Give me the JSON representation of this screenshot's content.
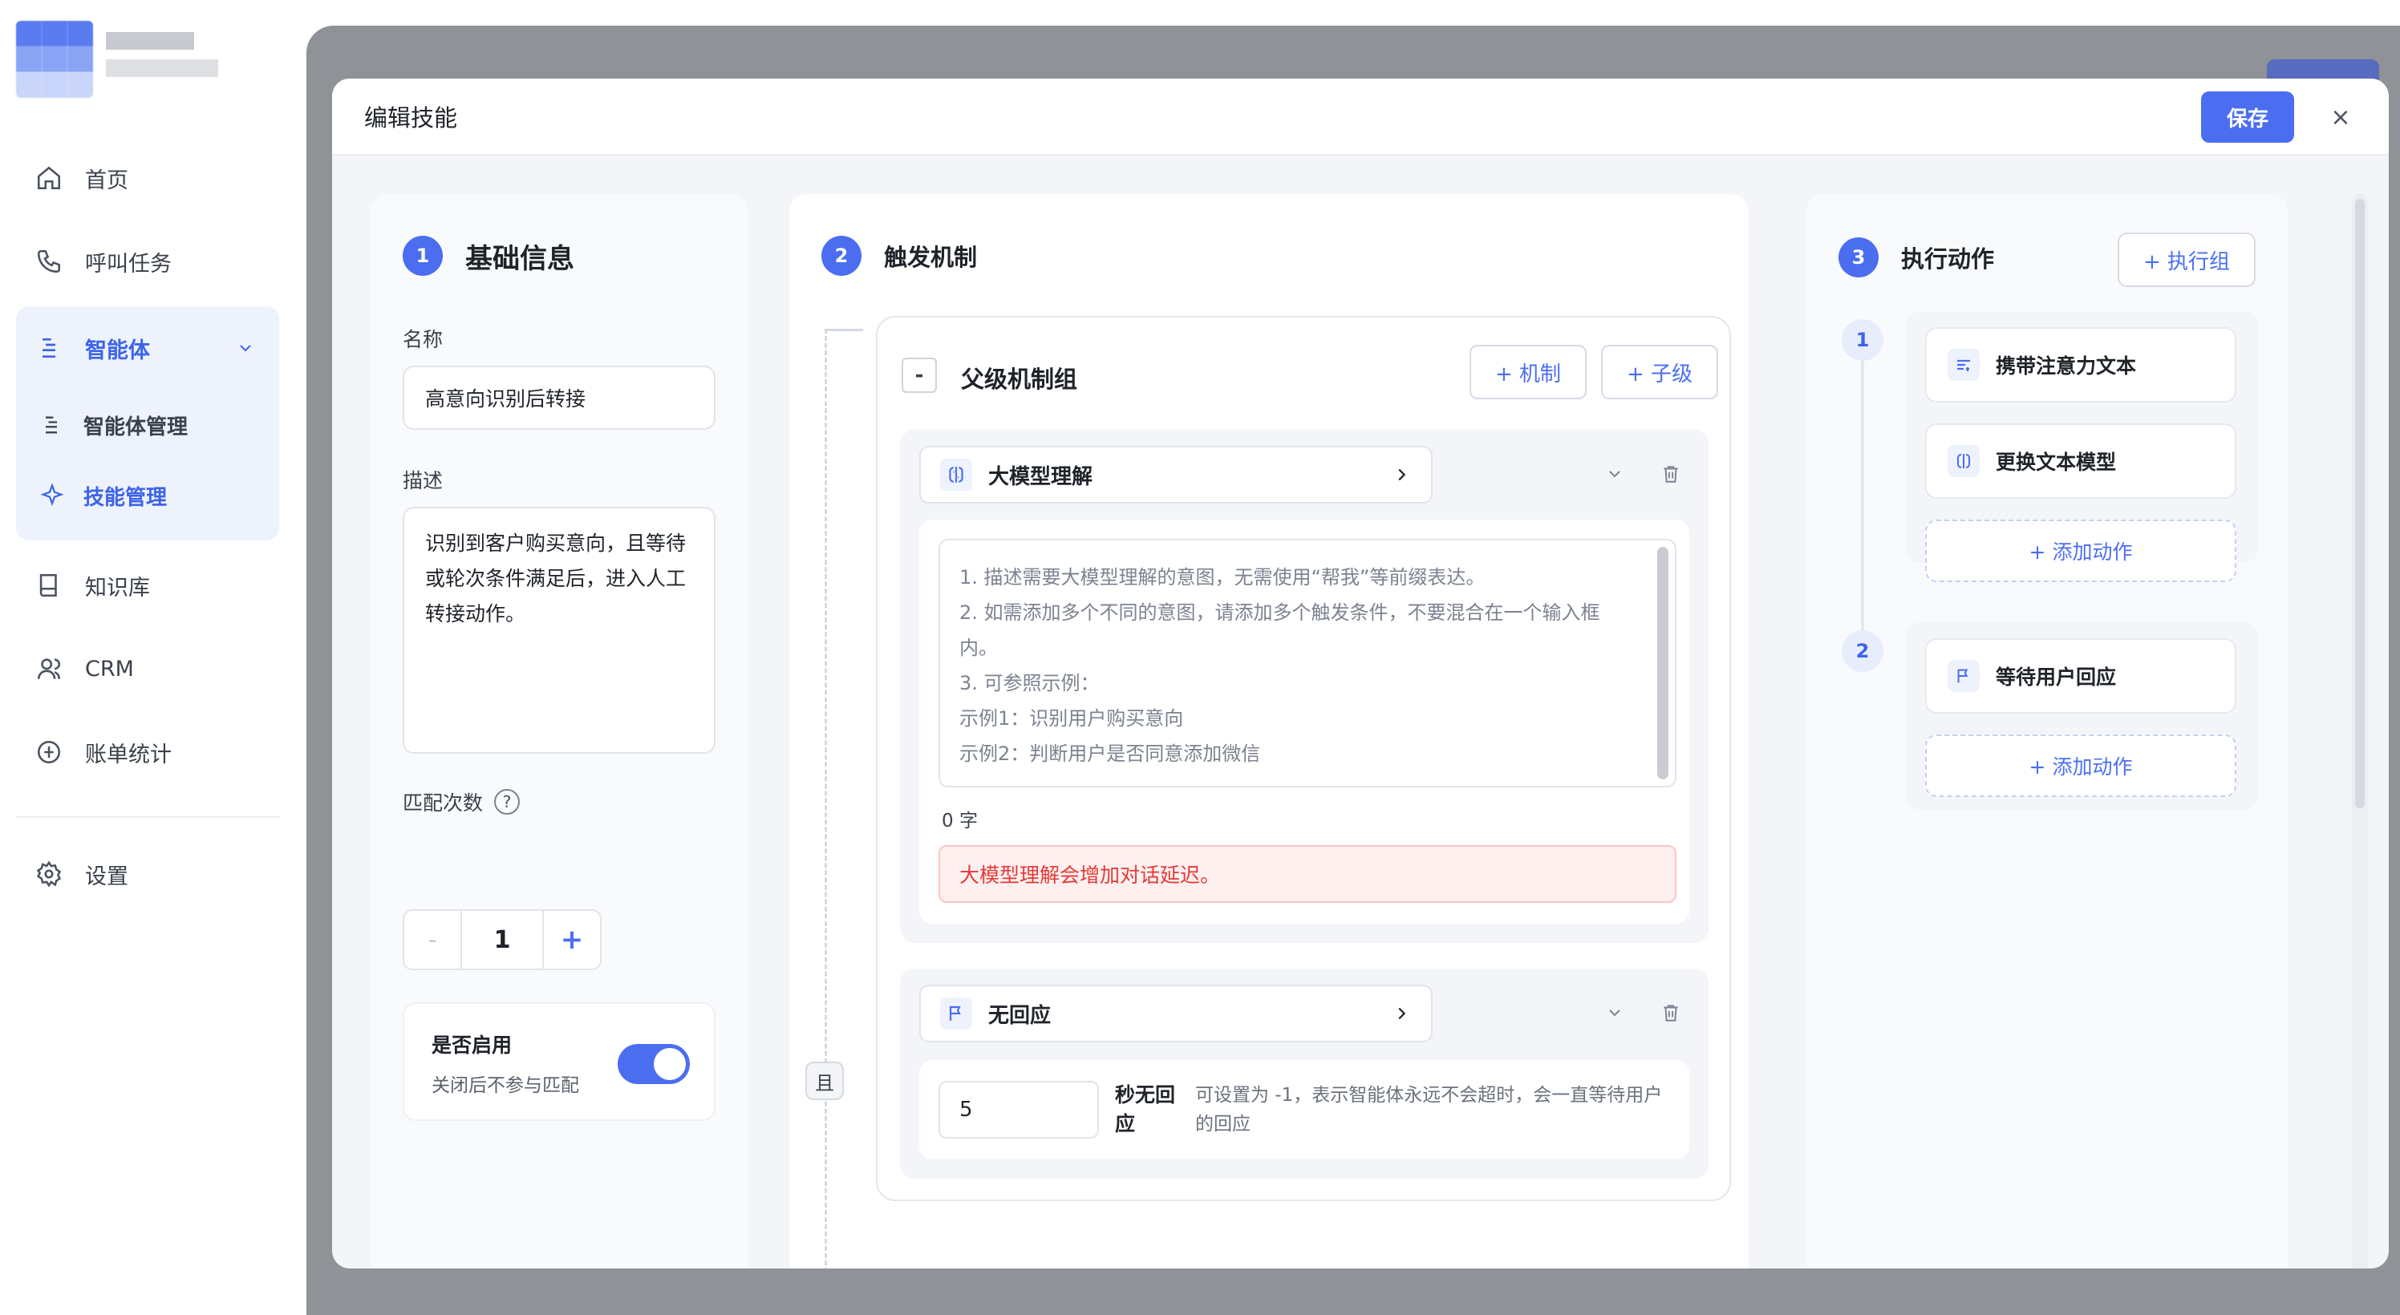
{
  "sidebar": {
    "items": [
      {
        "label": "首页",
        "icon": "home-icon"
      },
      {
        "label": "呼叫任务",
        "icon": "phone-icon"
      },
      {
        "label": "智能体",
        "icon": "agent-icon"
      },
      {
        "label": "知识库",
        "icon": "book-icon"
      },
      {
        "label": "CRM",
        "icon": "user-icon"
      },
      {
        "label": "账单统计",
        "icon": "billing-icon"
      },
      {
        "label": "设置",
        "icon": "gear-icon"
      }
    ],
    "sub_items": [
      {
        "label": "智能体管理",
        "icon": "agent-manage-icon"
      },
      {
        "label": "技能管理",
        "icon": "sparkle-icon"
      }
    ],
    "accent_color": "#3c64e8"
  },
  "modal": {
    "title": "编辑技能",
    "save_label": "保存",
    "close_glyph": "×"
  },
  "basic": {
    "step": "1",
    "title": "基础信息",
    "name_label": "名称",
    "name_value": "高意向识别后转接",
    "desc_label": "描述",
    "desc_value": "识别到客户购买意向，且等待或轮次条件满足后，进入人工转接动作。",
    "match_label": "匹配次数",
    "match_help": "?",
    "match_value": "1",
    "minus": "-",
    "plus": "+",
    "enable_title": "是否启用",
    "enable_desc": "关闭后不参与匹配",
    "enabled": true
  },
  "trigger": {
    "step": "2",
    "title": "触发机制",
    "and_label": "且",
    "group_collapse": "-",
    "group_title": "父级机制组",
    "add_mechanism": "+ 机制",
    "add_child": "+ 子级",
    "mechanisms": [
      {
        "label": "大模型理解",
        "placeholder_lines": [
          "1. 描述需要大模型理解的意图，无需使用“帮我”等前缀表达。",
          "2. 如需添加多个不同的意图，请添加多个触发条件，不要混合在一个输入框内。",
          "3. 可参照示例：",
          "示例1：识别用户购买意向",
          "示例2：判断用户是否同意添加微信"
        ],
        "char_count": "0 字",
        "warning": "大模型理解会增加对话延迟。"
      },
      {
        "label": "无回应",
        "timeout_value": "5",
        "timeout_unit": "秒无回应",
        "timeout_hint": "可设置为 -1，表示智能体永远不会超时，会一直等待用户的回应"
      }
    ]
  },
  "actions": {
    "step": "3",
    "title": "执行动作",
    "add_group": "+ 执行组",
    "groups": [
      {
        "num": "1",
        "items": [
          "携带注意力文本",
          "更换文本模型"
        ],
        "add_label": "+ 添加动作"
      },
      {
        "num": "2",
        "items": [
          "等待用户回应"
        ],
        "add_label": "+ 添加动作"
      }
    ]
  }
}
